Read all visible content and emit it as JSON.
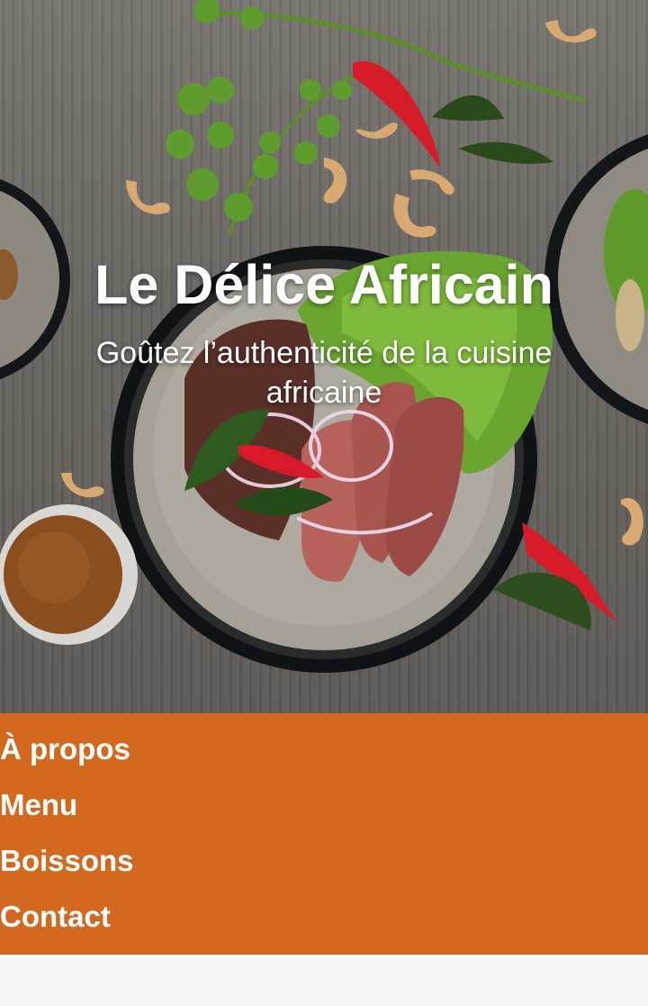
{
  "hero": {
    "title": "Le Délice Africain",
    "subtitle": "Goûtez l’authenticité de la cuisine africaine",
    "background_description": "grilled-steak-plate-photo"
  },
  "nav": {
    "items": [
      {
        "label": "À propos"
      },
      {
        "label": "Menu"
      },
      {
        "label": "Boissons"
      },
      {
        "label": "Contact"
      }
    ]
  },
  "colors": {
    "nav_background": "#d2691e",
    "text_light": "#ffffff",
    "page_background": "#f7f7f7"
  }
}
